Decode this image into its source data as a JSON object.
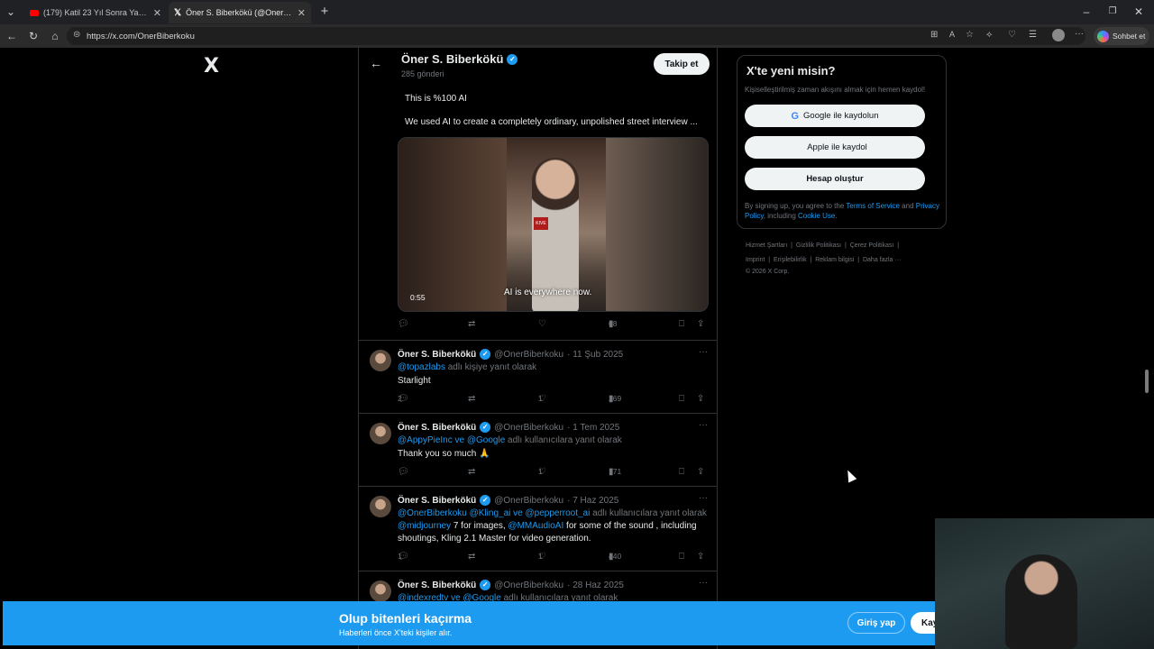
{
  "browser": {
    "tabs": [
      {
        "title": "(179) Katil 23 Yıl Sonra Yakalandığı",
        "active": false
      },
      {
        "title": "Öner S. Biberkökü (@OnerBiberku",
        "active": true
      }
    ],
    "url": "https://x.com/OnerBiberkoku",
    "copilot_label": "Sohbet et"
  },
  "x_logo": "X",
  "header": {
    "name": "Öner S. Biberkökü",
    "posts_count": "285 gönderi",
    "follow_label": "Takip et"
  },
  "quoted_post": {
    "line1": "This is %100 AI",
    "line2": "We used AI to create a completely ordinary, unpolished street interview ...",
    "video_duration": "0:55",
    "video_caption": "AI is everywhere now.",
    "views": "68"
  },
  "posts": [
    {
      "name": "Öner S. Biberkökü",
      "handle": "@OnerBiberkoku",
      "date": "· 11 Şub 2025",
      "reply_mentions": "@topazlabs",
      "reply_suffix": "adlı kişiye yanıt olarak",
      "text": "Starlight",
      "replies": "2",
      "likes": "1",
      "views": "269"
    },
    {
      "name": "Öner S. Biberkökü",
      "handle": "@OnerBiberkoku",
      "date": "· 1 Tem 2025",
      "reply_mentions": "@AppyPieInc ve @Google",
      "reply_suffix": "adlı kullanıcılara yanıt olarak",
      "text": "Thank you so much 🙏",
      "replies": "",
      "likes": "1",
      "views": "171"
    },
    {
      "name": "Öner S. Biberkökü",
      "handle": "@OnerBiberkoku",
      "date": "· 7 Haz 2025",
      "reply_mentions": "@OnerBiberkoku @Kling_ai ve @pepperroot_ai",
      "reply_suffix": "adlı kullanıcılara yanıt olarak",
      "text_mention1": "@midjourney",
      "text_part1": " 7 for images, ",
      "text_mention2": "@MMAudioAI",
      "text_part2": " for some of the sound , including shoutings, Kling 2.1 Master for video generation.",
      "replies": "1",
      "likes": "1",
      "views": "440"
    },
    {
      "name": "Öner S. Biberkökü",
      "handle": "@OnerBiberkoku",
      "date": "· 28 Haz 2025",
      "reply_mentions": "@indexredtv ve @Google",
      "reply_suffix": "adlı kullanıcılara yanıt olarak"
    }
  ],
  "signup": {
    "title": "X'te yeni misin?",
    "subtitle": "Kişiselleştirilmiş zaman akışını almak için hemen kaydol!",
    "google_label": "Google ile kaydolun",
    "apple_label": "Apple ile kaydol",
    "create_label": "Hesap oluştur",
    "terms_prefix": "By signing up, you agree to the ",
    "terms_link": "Terms of Service",
    "terms_and": " and ",
    "privacy_link": "Privacy Policy",
    "terms_including": ", including ",
    "cookie_link": "Cookie Use."
  },
  "footer": {
    "row1": [
      "Hizmet Şartları",
      "Gizlilik Politikası",
      "Çerez Politikası"
    ],
    "row2": [
      "Imprint",
      "Erişilebilirlik",
      "Reklam bilgisi",
      "Daha fazla ···"
    ],
    "copyright": "© 2026 X Corp."
  },
  "banner": {
    "title": "Olup bitenleri kaçırma",
    "subtitle": "Haberleri önce X'teki kişiler alır.",
    "login_label": "Giriş yap",
    "register_label": "Kay"
  },
  "colors": {
    "accent": "#1d9bf0",
    "background": "#000000",
    "muted": "#71767b"
  }
}
